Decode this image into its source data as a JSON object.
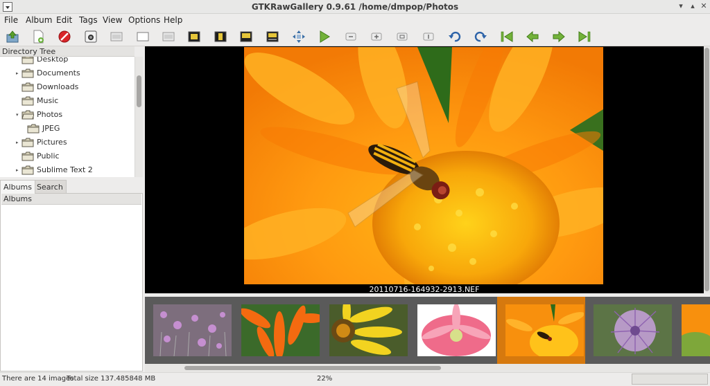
{
  "window": {
    "title": "GTKRawGallery 0.9.61    /home/dmpop/Photos",
    "controls": [
      "minimize-icon",
      "maximize-icon",
      "close-icon"
    ]
  },
  "menu": [
    "File",
    "Album",
    "Edit",
    "Tags",
    "View",
    "Options",
    "Help"
  ],
  "toolbar": [
    "import-icon",
    "add-to-album-icon",
    "stop-icon",
    "screenshot-icon",
    "layout-1-icon",
    "layout-2-icon",
    "layout-3-icon",
    "layout-4-icon",
    "layout-5-icon",
    "layout-6-icon",
    "layout-7-icon",
    "fit-window-icon",
    "slideshow-play-icon",
    "zoom-out-icon",
    "zoom-in-icon",
    "zoom-fit-icon",
    "zoom-100-icon",
    "rotate-left-icon",
    "rotate-right-icon",
    "first-image-icon",
    "previous-image-icon",
    "next-image-icon",
    "last-image-icon"
  ],
  "directory_tree": {
    "header": "Directory Tree",
    "items": [
      {
        "label": "Desktop",
        "level": 0,
        "expander": ""
      },
      {
        "label": "Documents",
        "level": 0,
        "expander": "▸"
      },
      {
        "label": "Downloads",
        "level": 0,
        "expander": ""
      },
      {
        "label": "Music",
        "level": 0,
        "expander": ""
      },
      {
        "label": "Photos",
        "level": 0,
        "expander": "▾"
      },
      {
        "label": "JPEG",
        "level": 1,
        "expander": ""
      },
      {
        "label": "Pictures",
        "level": 0,
        "expander": "▸"
      },
      {
        "label": "Public",
        "level": 0,
        "expander": ""
      },
      {
        "label": "Sublime Text 2",
        "level": 0,
        "expander": "▸"
      }
    ]
  },
  "tabs": [
    {
      "label": "Albums",
      "active": true
    },
    {
      "label": "Search",
      "active": false
    }
  ],
  "albums": {
    "header": "Albums"
  },
  "viewer": {
    "caption": "20110716-164932-2913.NEF"
  },
  "filmstrip": [
    {
      "name": "pink-flowers-thumb",
      "selected": false
    },
    {
      "name": "orange-petals-thumb",
      "selected": false
    },
    {
      "name": "yellow-daisy-thumb",
      "selected": false
    },
    {
      "name": "pink-gerbera-thumb",
      "selected": false
    },
    {
      "name": "hoverfly-orange-flower-thumb",
      "selected": true
    },
    {
      "name": "purple-thistle-thumb",
      "selected": false
    },
    {
      "name": "orange-partial-thumb",
      "selected": false
    }
  ],
  "status": {
    "count": "There are 14 images",
    "size": "Total size 137.485848 MB",
    "zoom": "22%"
  },
  "colors": {
    "selection": "#d6790e",
    "filmstrip_bg": "#5a5a5a",
    "viewer_bg": "#000000"
  }
}
